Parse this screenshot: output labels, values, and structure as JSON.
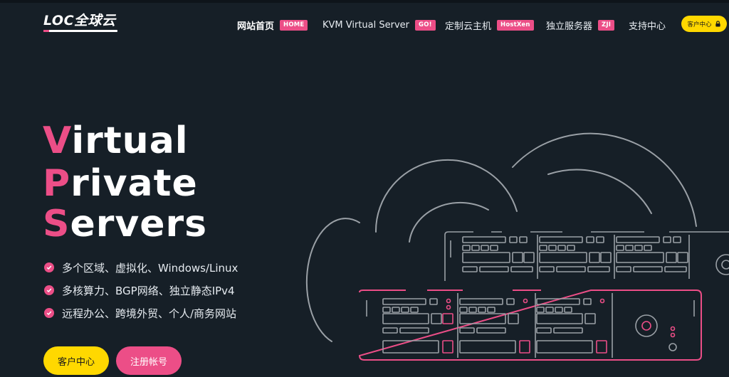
{
  "logo": {
    "text": "LOC全球云"
  },
  "nav": [
    {
      "label": "网站首页",
      "badge": "HOME",
      "active": true
    },
    {
      "label": "KVM Virtual Server",
      "badge": "GO!",
      "active": false
    },
    {
      "label": "定制云主机",
      "badge": "HostXen",
      "active": false
    },
    {
      "label": "独立服务器",
      "badge": "ZJI",
      "active": false
    },
    {
      "label": "支持中心",
      "badge": "",
      "active": false
    }
  ],
  "header": {
    "client_button": "客户中心"
  },
  "hero": {
    "lines": [
      {
        "first": "V",
        "rest": "irtual"
      },
      {
        "first": "P",
        "rest": "rivate"
      },
      {
        "first": "S",
        "rest": "ervers"
      }
    ]
  },
  "features": [
    "多个区域、虚拟化、Windows/Linux",
    "多核算力、BGP网络、独立静态IPv4",
    "远程办公、跨境外贸、个人/商务网站"
  ],
  "buttons": {
    "client": "客户中心",
    "register": "注册帐号"
  },
  "colors": {
    "background": "#161f27",
    "accent": "#ec4e87",
    "yellow": "#ffd800",
    "line": "#9aa0a6"
  },
  "icons": [
    "lock-icon",
    "check-icon",
    "cloud-illustration",
    "server-rack-icon"
  ]
}
